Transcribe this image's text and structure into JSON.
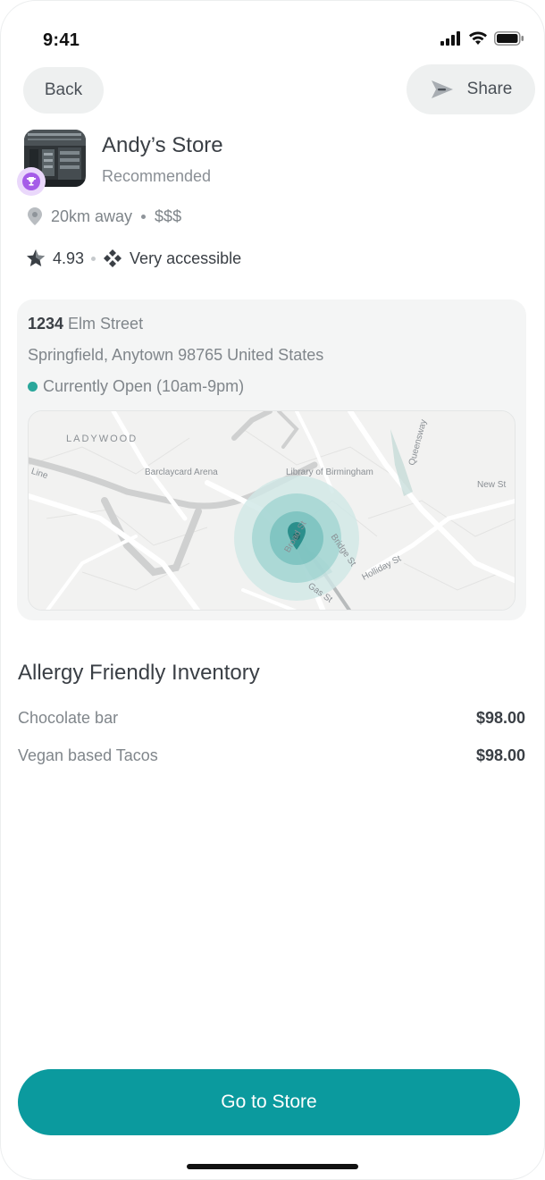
{
  "status_bar": {
    "time": "9:41"
  },
  "nav": {
    "back_label": "Back",
    "share_label": "Share"
  },
  "store": {
    "name": "Andy’s Store",
    "subtitle": "Recommended",
    "distance": "20km away",
    "price_level": "$$$",
    "rating": "4.93",
    "accessibility": "Very accessible"
  },
  "address": {
    "street_number": "1234",
    "street_name": " Elm Street",
    "city_line": "Springfield, Anytown 98765 United States",
    "hours": "Currently Open (10am-9pm)"
  },
  "map": {
    "labels": {
      "ladywood": "LADYWOOD",
      "barclaycard": "Barclaycard Arena",
      "library": "Library of Birmingham",
      "queensway": "Queensway",
      "new_st": "New St",
      "broad_st": "Broad St",
      "bridge_st": "Bridge St",
      "holliday_st": "Holliday St",
      "gas_st": "Gas St",
      "line": "Line"
    },
    "accent_color": "#2aa79b"
  },
  "inventory": {
    "title": "Allergy Friendly Inventory",
    "items": [
      {
        "name": "Chocolate bar",
        "price": "$98.00"
      },
      {
        "name": "Vegan based Tacos",
        "price": "$98.00"
      }
    ]
  },
  "cta": {
    "label": "Go to Store"
  },
  "colors": {
    "primary": "#0b9a9e",
    "badge": "#a55ce8",
    "open": "#2aa79b"
  },
  "icons": [
    "signal-icon",
    "wifi-icon",
    "battery-icon",
    "share-icon",
    "location-pin-icon",
    "star-icon",
    "accessibility-icon",
    "trophy-icon"
  ]
}
